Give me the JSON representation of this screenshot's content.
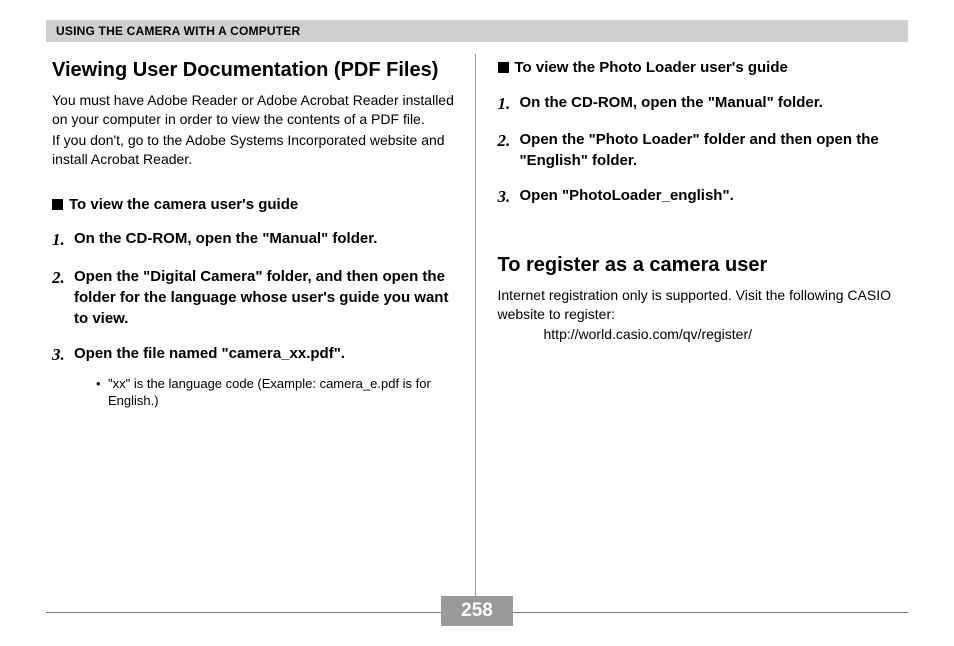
{
  "header": "USING THE CAMERA WITH A COMPUTER",
  "left": {
    "title": "Viewing User Documentation (PDF Files)",
    "intro1": "You must have Adobe Reader or Adobe Acrobat Reader installed on your computer in order to view the contents of a PDF file.",
    "intro2": "If you don't, go to the Adobe Systems Incorporated website and install Acrobat Reader.",
    "subhead": "To view the camera user's guide",
    "steps": {
      "s1": "On the CD-ROM, open the \"Manual\" folder.",
      "s2": "Open the \"Digital Camera\" folder, and then open the folder for the language whose user's guide you want to view.",
      "s3": "Open the file named \"camera_xx.pdf\"."
    },
    "note": "\"xx\" is the language code (Example: camera_e.pdf is for English.)"
  },
  "right": {
    "subhead": "To view the Photo Loader user's guide",
    "steps": {
      "s1": "On the CD-ROM, open the \"Manual\" folder.",
      "s2": "Open the \"Photo Loader\" folder and then open the \"English\" folder.",
      "s3": "Open \"PhotoLoader_english\"."
    },
    "section2_title": "To register as a camera user",
    "section2_body": "Internet registration only is supported. Visit the following CASIO website to register:",
    "section2_url": "http://world.casio.com/qv/register/"
  },
  "page_number": "258"
}
